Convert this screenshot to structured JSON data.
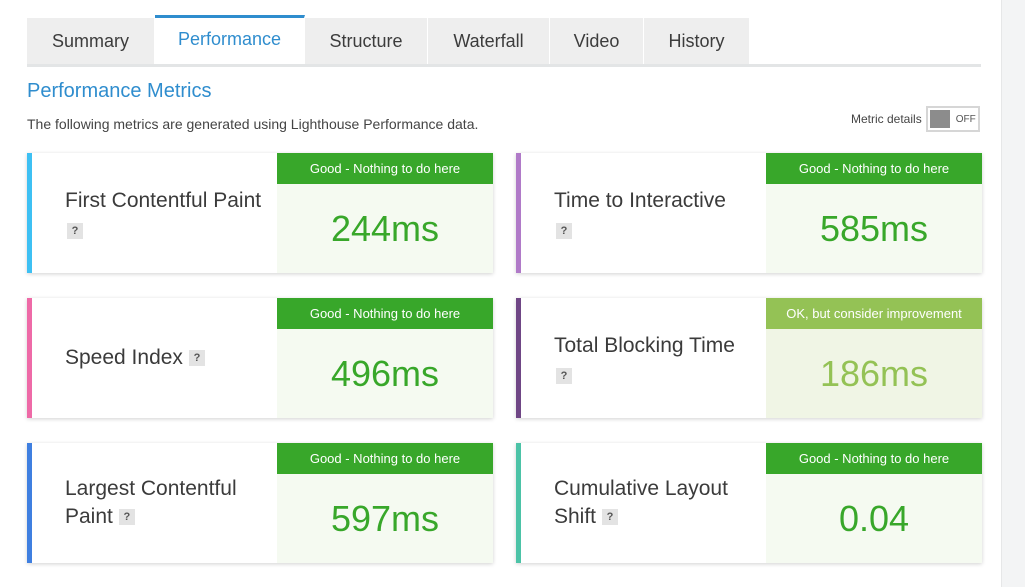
{
  "tabs": [
    {
      "label": "Summary",
      "active": false
    },
    {
      "label": "Performance",
      "active": true
    },
    {
      "label": "Structure",
      "active": false
    },
    {
      "label": "Waterfall",
      "active": false
    },
    {
      "label": "Video",
      "active": false
    },
    {
      "label": "History",
      "active": false
    }
  ],
  "header": {
    "title": "Performance Metrics",
    "description": "The following metrics are generated using Lighthouse Performance data.",
    "metric_details_label": "Metric details",
    "toggle_state": "OFF"
  },
  "metrics": [
    {
      "name": "First Contentful Paint",
      "status": "Good - Nothing to do here",
      "value": "244ms",
      "accent": "#3ec0f3"
    },
    {
      "name": "Time to Interactive",
      "status": "Good - Nothing to do here",
      "value": "585ms",
      "accent": "#b07ac8"
    },
    {
      "name": "Speed Index",
      "status": "Good - Nothing to do here",
      "value": "496ms",
      "accent": "#ee6aa7"
    },
    {
      "name": "Total Blocking Time",
      "status": "OK, but consider improvement",
      "value": "186ms",
      "accent": "#6f4685"
    },
    {
      "name": "Largest Contentful Paint",
      "status": "Good - Nothing to do here",
      "value": "597ms",
      "accent": "#3f7fe0"
    },
    {
      "name": "Cumulative Layout Shift",
      "status": "Good - Nothing to do here",
      "value": "0.04",
      "accent": "#4cc3a7"
    }
  ],
  "colors": {
    "link_blue": "#2f8dce",
    "good_green": "#38a72a",
    "ok_green": "#94c255"
  }
}
